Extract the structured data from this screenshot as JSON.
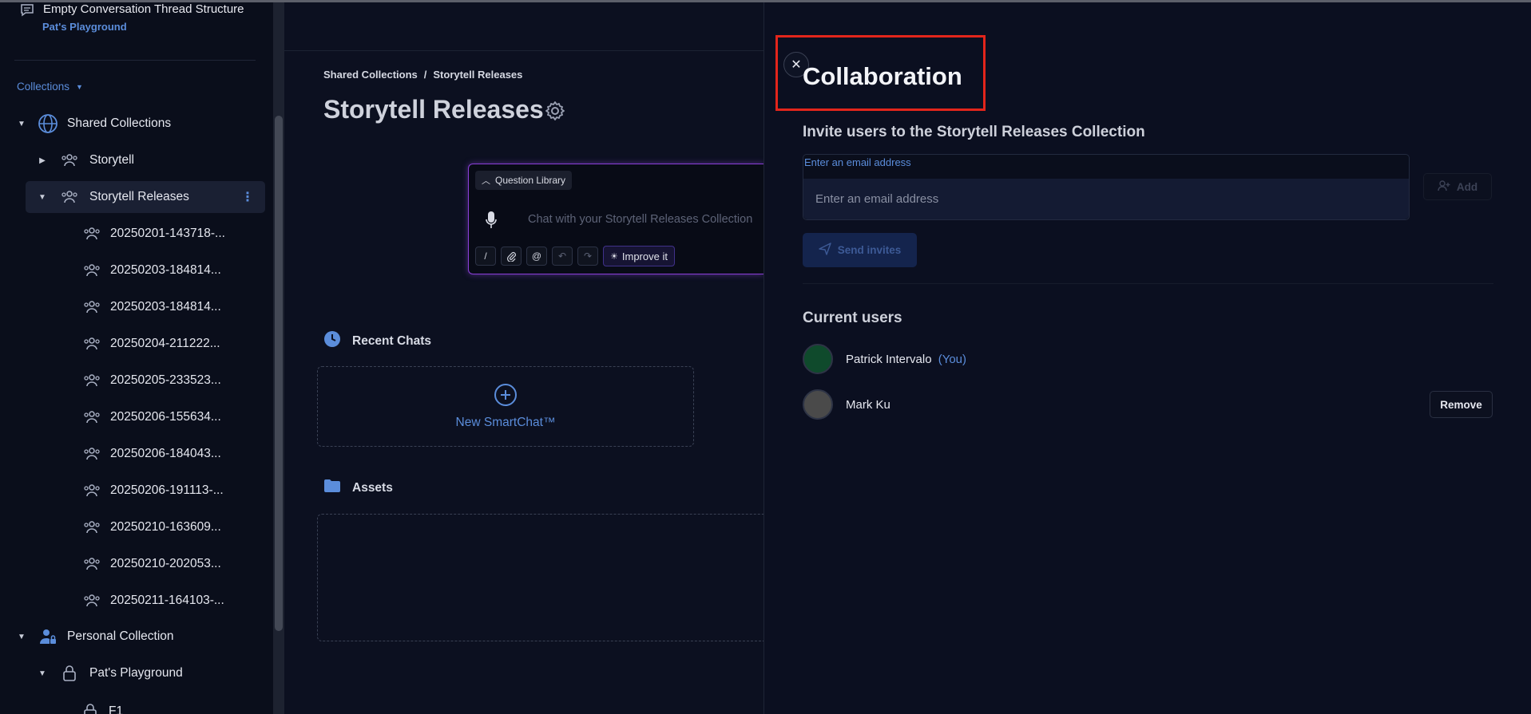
{
  "sidebar": {
    "thread_title": "Empty Conversation Thread Structure",
    "thread_subtitle": "Pat's Playground",
    "collections_label": "Collections",
    "shared_collections": "Shared Collections",
    "storytell": "Storytell",
    "storytell_releases": "Storytell Releases",
    "release_items": [
      "20250201-143718-...",
      "20250203-184814...",
      "20250203-184814...",
      "20250204-211222...",
      "20250205-233523...",
      "20250206-155634...",
      "20250206-184043...",
      "20250206-191113-...",
      "20250210-163609...",
      "20250210-202053...",
      "20250211-164103-..."
    ],
    "personal_collection": "Personal Collection",
    "pats_playground": "Pat's Playground",
    "f1": "F1"
  },
  "main": {
    "breadcrumb": [
      "Shared Collections",
      "/",
      "Storytell Releases"
    ],
    "title": "Storytell Releases",
    "question_library": "Question Library",
    "chat_placeholder": "Chat with your Storytell Releases Collection",
    "improve_label": "Improve it",
    "tools": [
      "/",
      "@"
    ],
    "recent_chats": "Recent Chats",
    "new_smartchat": "New SmartChat™",
    "assets": "Assets"
  },
  "panel": {
    "title": "Collaboration",
    "invite_heading": "Invite users to the Storytell Releases Collection",
    "email_label": "Enter an email address",
    "email_placeholder": "Enter an email address",
    "add_label": "Add",
    "send_label": "Send invites",
    "current_users_heading": "Current users",
    "users": [
      {
        "name": "Patrick Intervalo",
        "tag": "(You)",
        "avatar_color": "#0f4a2c"
      },
      {
        "name": "Mark Ku",
        "tag": "",
        "avatar_color": "#4a4a4a"
      }
    ],
    "remove_label": "Remove"
  },
  "colors": {
    "accent": "#5b8ddb",
    "highlight": "#e3251b",
    "chat_border": "#8a3fd8"
  },
  "icons": {
    "thread": "chat-bubble-icon",
    "shared": "globe-icon",
    "group": "users-icon",
    "personal": "user-lock-icon",
    "lock": "lock-icon",
    "gear": "gear-icon",
    "mic": "microphone-icon",
    "clock": "clock-icon",
    "folder": "folder-icon",
    "plus": "plus-circle-icon",
    "close": "close-icon",
    "send": "send-icon",
    "add_user": "add-user-icon"
  }
}
